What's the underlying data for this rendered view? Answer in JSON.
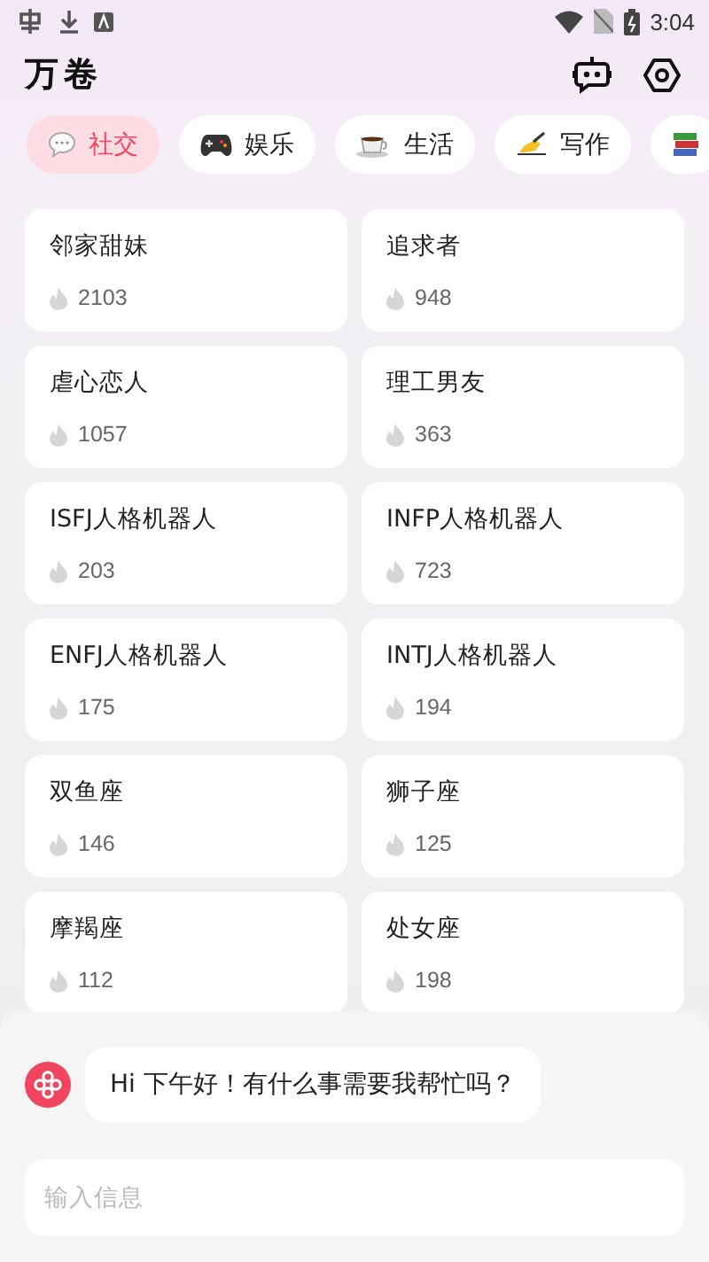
{
  "status_bar": {
    "time": "3:04"
  },
  "header": {
    "title": "万卷"
  },
  "tabs": [
    {
      "label": "社交",
      "selected": true
    },
    {
      "label": "娱乐",
      "selected": false
    },
    {
      "label": "生活",
      "selected": false
    },
    {
      "label": "写作",
      "selected": false
    },
    {
      "selected": false
    }
  ],
  "cards": [
    {
      "name": "邻家甜妹",
      "count": "2103"
    },
    {
      "name": "追求者",
      "count": "948"
    },
    {
      "name": "虐心恋人",
      "count": "1057"
    },
    {
      "name": "理工男友",
      "count": "363"
    },
    {
      "name": "ISFJ人格机器人",
      "count": "203"
    },
    {
      "name": "INFP人格机器人",
      "count": "723"
    },
    {
      "name": "ENFJ人格机器人",
      "count": "175"
    },
    {
      "name": "INTJ人格机器人",
      "count": "194"
    },
    {
      "name": "双鱼座",
      "count": "146"
    },
    {
      "name": "狮子座",
      "count": "125"
    },
    {
      "name": "摩羯座",
      "count": "112"
    },
    {
      "name": "处女座",
      "count": "198"
    }
  ],
  "chat": {
    "message": "Hi 下午好！有什么事需要我帮忙吗？",
    "input": {
      "placeholder": "输入信息"
    }
  }
}
